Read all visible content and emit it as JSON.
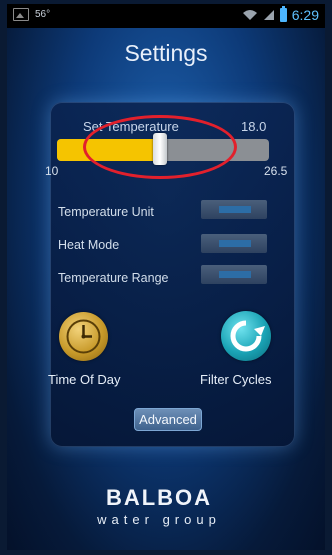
{
  "statusbar": {
    "temp": "56°",
    "time": "6:29",
    "icons": [
      "image-icon",
      "wifi-icon",
      "signal-icon",
      "battery-icon"
    ]
  },
  "screen": {
    "title": "Settings"
  },
  "set_temperature": {
    "label": "Set Temperature",
    "value": "18.0",
    "min_label": "10",
    "max_label": "26.5",
    "fill_fraction": 0.52
  },
  "rows": [
    {
      "label": "Temperature Unit"
    },
    {
      "label": "Heat Mode"
    },
    {
      "label": "Temperature Range"
    }
  ],
  "shortcuts": {
    "time_of_day": "Time Of Day",
    "filter_cycles": "Filter Cycles"
  },
  "advanced_label": "Advanced",
  "logo": {
    "line1": "BALBOA",
    "line2": "water group"
  },
  "colors": {
    "accent_slider": "#f5c400",
    "highlight": "#e2202c",
    "background": "#0d3a78"
  }
}
